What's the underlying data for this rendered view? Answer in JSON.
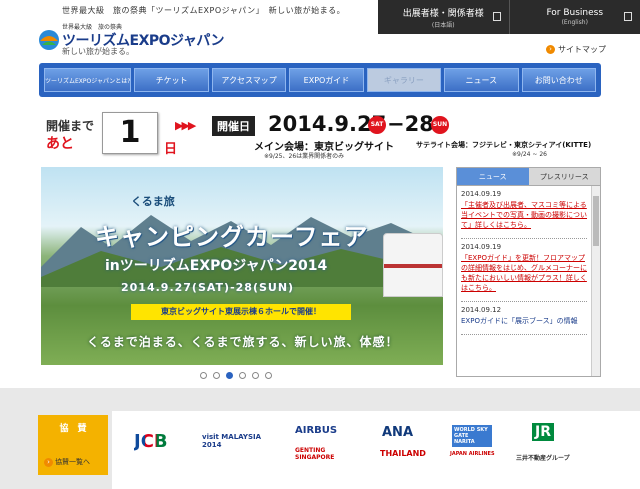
{
  "header": {
    "tagline": "世界最大級　旅の祭典「ツーリズムEXPOジャパン」　新しい旅が始まる。",
    "logo_top": "世界最大級　旅の祭典",
    "logo_main": "ツーリズムEXPOジャパン",
    "logo_sub": "新しい旅が始まる。",
    "top_buttons": [
      {
        "label": "出展者様・関係者様",
        "sub": "(日本語)"
      },
      {
        "label": "For Business",
        "sub": "(English)"
      }
    ],
    "sitemap": "サイトマップ"
  },
  "nav": {
    "items": [
      "ツーリズムEXPOジャパンとは?",
      "チケット",
      "アクセスマップ",
      "EXPOガイド",
      "ギャラリー",
      "ニュース",
      "お問い合わせ"
    ]
  },
  "countdown": {
    "label1": "開催まで",
    "label2": "あと",
    "days": "1",
    "unit": "日",
    "arrows": "▶▶▶"
  },
  "event": {
    "badge": "開催日",
    "date_start": "2014.9.27",
    "sat": "SAT",
    "date_end": "−28",
    "sun": "SUN",
    "main_venue": "メイン会場：東京ビッグサイト",
    "satellite_venue": "サテライト会場：フジテレビ・東京シティアイ(KITTE)",
    "note1": "※9/25、26は業界関係者のみ",
    "note2": "※9/24 ~ 26"
  },
  "banner": {
    "tag": "くるま旅",
    "title": "キャンピングカーフェア",
    "subtitle": "inツーリズムEXPOジャパン2014",
    "date": "2014.9.27(SAT)-28(SUN)",
    "yellow": "東京ビッグサイト東展示棟６ホールで開催！",
    "bottom": "くるまで泊まる、くるまで旅する、新しい旅、体感！"
  },
  "news": {
    "tabs": [
      "ニュース",
      "プレスリリース"
    ],
    "items": [
      {
        "date": "2014.09.19",
        "text": "「主催者及び出展者、マスコミ等による当イベントでの写真・動画の撮影について」詳しくはこちら。"
      },
      {
        "date": "2014.09.19",
        "text": "「EXPOガイド」を更新！フロアマップの詳細情報をはじめ、グルメコーナーにも新たにおいしい情報がプラス！詳しくはこちら。"
      },
      {
        "date": "2014.09.12",
        "text": "EXPOガイドに「展示ブース」の情報"
      }
    ]
  },
  "sponsors": {
    "label": "協　賛",
    "link": "協賛一覧へ",
    "logos": [
      "JCB",
      "visit MALAYSIA 2014",
      "AIRBUS",
      "GENTING SINGAPORE",
      "ANA",
      "THAILAND",
      "WORLD SKY GATE NARITA",
      "JAPAN AIRLINES",
      "JR",
      "三井不動産グループ"
    ]
  },
  "colors": {
    "accent": "#2a63c0",
    "red": "#e0141e",
    "yellow": "#ffe400",
    "sponsor": "#f4b200"
  }
}
